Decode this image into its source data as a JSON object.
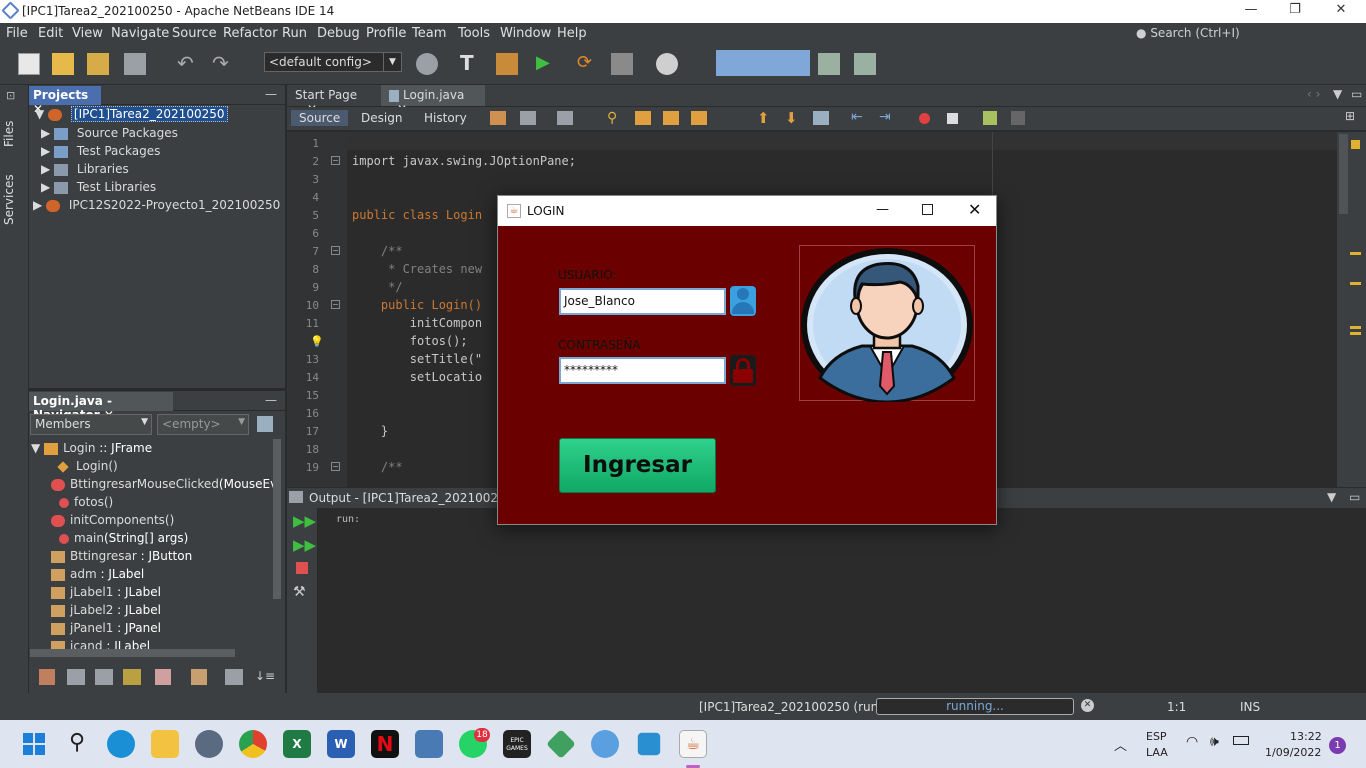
{
  "window": {
    "title": "[IPC1]Tarea2_202100250 - Apache NetBeans IDE 14",
    "min": "—",
    "max": "❐",
    "close": "✕"
  },
  "menu": [
    "File",
    "Edit",
    "View",
    "Navigate",
    "Source",
    "Refactor",
    "Run",
    "Debug",
    "Profile",
    "Team",
    "Tools",
    "Window",
    "Help"
  ],
  "search_placeholder": "Search (Ctrl+I)",
  "toolbar": {
    "config": "<default config>"
  },
  "side_tabs": [
    "Files",
    "Services"
  ],
  "projects": {
    "tab": "Projects",
    "items": [
      {
        "label": "[IPC1]Tarea2_202100250",
        "level": 0
      },
      {
        "label": "Source Packages",
        "level": 1
      },
      {
        "label": "Test Packages",
        "level": 1
      },
      {
        "label": "Libraries",
        "level": 1
      },
      {
        "label": "Test Libraries",
        "level": 1
      },
      {
        "label": "IPC12S2022-Proyecto1_202100250",
        "level": 0
      }
    ]
  },
  "navigator": {
    "tab": "Login.java - Navigator",
    "members": "Members",
    "filter": "<empty>",
    "items": [
      {
        "name": "Login",
        "type": " :: JFrame"
      },
      {
        "name": "Login()",
        "type": ""
      },
      {
        "name": "BttingresarMouseClicked",
        "type": "(MouseEv"
      },
      {
        "name": "fotos()",
        "type": ""
      },
      {
        "name": "initComponents()",
        "type": ""
      },
      {
        "name": "main",
        "type": "(String[] args)"
      },
      {
        "name": "Bttingresar",
        "type": " : JButton"
      },
      {
        "name": "adm",
        "type": " : JLabel"
      },
      {
        "name": "jLabel1",
        "type": " : JLabel"
      },
      {
        "name": "jLabel2",
        "type": " : JLabel"
      },
      {
        "name": "jPanel1",
        "type": " : JPanel"
      },
      {
        "name": "icand",
        "type": " : JLabel"
      }
    ]
  },
  "editor": {
    "tabs": [
      "Start Page",
      "Login.java"
    ],
    "modes": [
      "Source",
      "Design",
      "History"
    ],
    "lines": [
      {
        "n": "1",
        "t": ""
      },
      {
        "n": "2",
        "t": "import javax.swing.JOptionPane;"
      },
      {
        "n": "3",
        "t": ""
      },
      {
        "n": "4",
        "t": ""
      },
      {
        "n": "5",
        "t": "public class Login"
      },
      {
        "n": "6",
        "t": ""
      },
      {
        "n": "7",
        "t": "    /**"
      },
      {
        "n": "8",
        "t": "     * Creates new"
      },
      {
        "n": "9",
        "t": "     */"
      },
      {
        "n": "10",
        "t": "    public Login()"
      },
      {
        "n": "11",
        "t": "        initCompon"
      },
      {
        "n": "",
        "t": "        fotos();"
      },
      {
        "n": "13",
        "t": "        setTitle(\""
      },
      {
        "n": "14",
        "t": "        setLocatio"
      },
      {
        "n": "15",
        "t": ""
      },
      {
        "n": "16",
        "t": ""
      },
      {
        "n": "17",
        "t": "    }"
      },
      {
        "n": "18",
        "t": ""
      },
      {
        "n": "19",
        "t": "    /**"
      }
    ]
  },
  "output": {
    "title": "Output - [IPC1]Tarea2_20210025",
    "text": "run:"
  },
  "status": {
    "project": "[IPC1]Tarea2_202100250 (run)",
    "progress": "running...",
    "pos": "1:1",
    "mode": "INS"
  },
  "dialog": {
    "title": "LOGIN",
    "user_label": "USUARIO:",
    "user_value": "Jose_Blanco",
    "pass_label": "CONTRASEÑA",
    "pass_value": "*********",
    "button": "Ingresar"
  },
  "taskbar": {
    "lang1": "ESP",
    "lang2": "LAA",
    "time": "13:22",
    "date": "1/09/2022",
    "whatsapp_badge": "18",
    "notif": "1",
    "epic": "EPIC GAMES"
  }
}
